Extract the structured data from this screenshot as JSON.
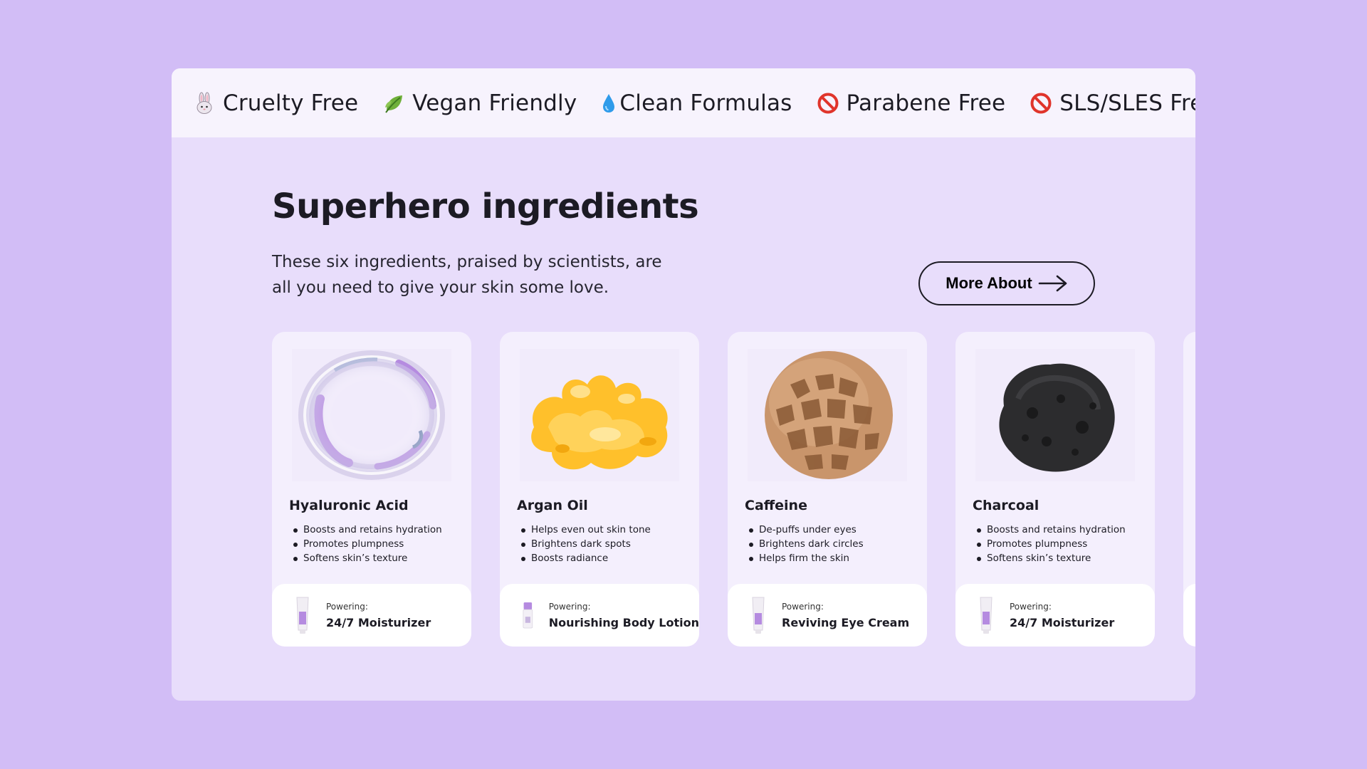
{
  "badges": [
    {
      "icon": "rabbit-icon",
      "label": "Cruelty Free"
    },
    {
      "icon": "leaf-icon",
      "label": "Vegan Friendly"
    },
    {
      "icon": "droplet-icon",
      "label": "Clean Formulas"
    },
    {
      "icon": "prohibited-icon",
      "label": "Parabene Free"
    },
    {
      "icon": "prohibited-icon",
      "label": "SLS/SLES Free"
    }
  ],
  "section": {
    "title": "Superhero ingredients",
    "subtitle": "These six ingredients, praised by scientists, are all you need to give your skin some love.",
    "more_button": "More About"
  },
  "cards": [
    {
      "name": "Hyaluronic Acid",
      "bullets": [
        "Boosts and retains hydration",
        "Promotes plumpness",
        "Softens skin’s texture"
      ],
      "powering_label": "Powering:",
      "product": "24/7 Moisturizer"
    },
    {
      "name": "Argan Oil",
      "bullets": [
        "Helps even out skin tone",
        "Brightens dark spots",
        "Boosts radiance"
      ],
      "powering_label": "Powering:",
      "product": "Nourishing Body Lotion"
    },
    {
      "name": "Caffeine",
      "bullets": [
        "De-puffs under eyes",
        "Brightens dark circles",
        "Helps firm the skin"
      ],
      "powering_label": "Powering:",
      "product": "Reviving Eye Cream"
    },
    {
      "name": "Charcoal",
      "bullets": [
        "Boosts and retains hydration",
        "Promotes plumpness",
        "Softens skin’s texture"
      ],
      "powering_label": "Powering:",
      "product": "24/7 Moisturizer"
    }
  ],
  "colors": {
    "background": "#d2bdf6",
    "panel": "#e8ddfb",
    "badge_bar": "#f7f3fd",
    "card": "#f4effd",
    "text": "#1c1b24",
    "accent_purple": "#b58be0"
  }
}
